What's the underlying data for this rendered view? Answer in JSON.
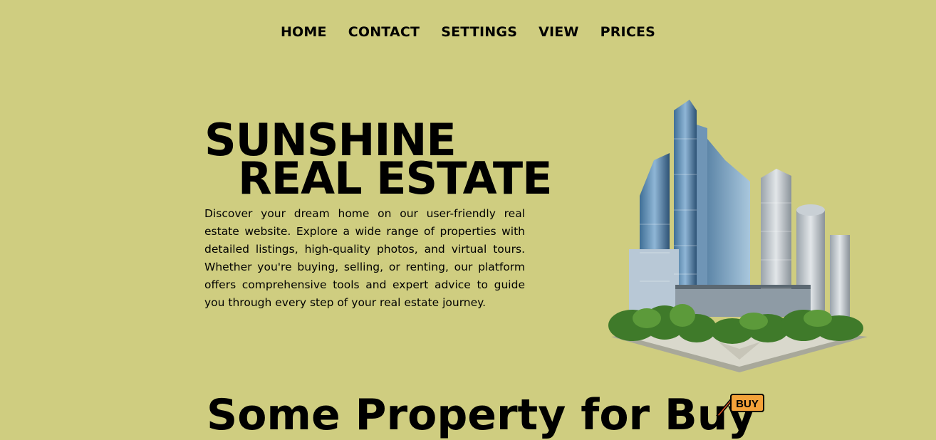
{
  "nav": {
    "items": [
      "HOME",
      "CONTACT",
      "SETTINGS",
      "VIEW",
      "PRICES"
    ]
  },
  "hero": {
    "title_line1": "SUNSHINE",
    "title_line2": "REAL ESTATE",
    "description": "Discover your dream home on our user-friendly real estate website. Explore a wide range of properties with detailed listings, high-quality photos, and virtual tours. Whether you're buying, selling, or renting, our platform offers comprehensive tools and expert advice to guide you through every step of your real estate journey."
  },
  "section": {
    "title": "Some Property for Buy",
    "badge": "BUY"
  },
  "colors": {
    "background": "#cfcd80",
    "text": "#000000",
    "badge_accent": "#f4a23a"
  },
  "icons": {
    "illustration": "city-buildings-illustration",
    "badge": "buy-sign-icon"
  }
}
